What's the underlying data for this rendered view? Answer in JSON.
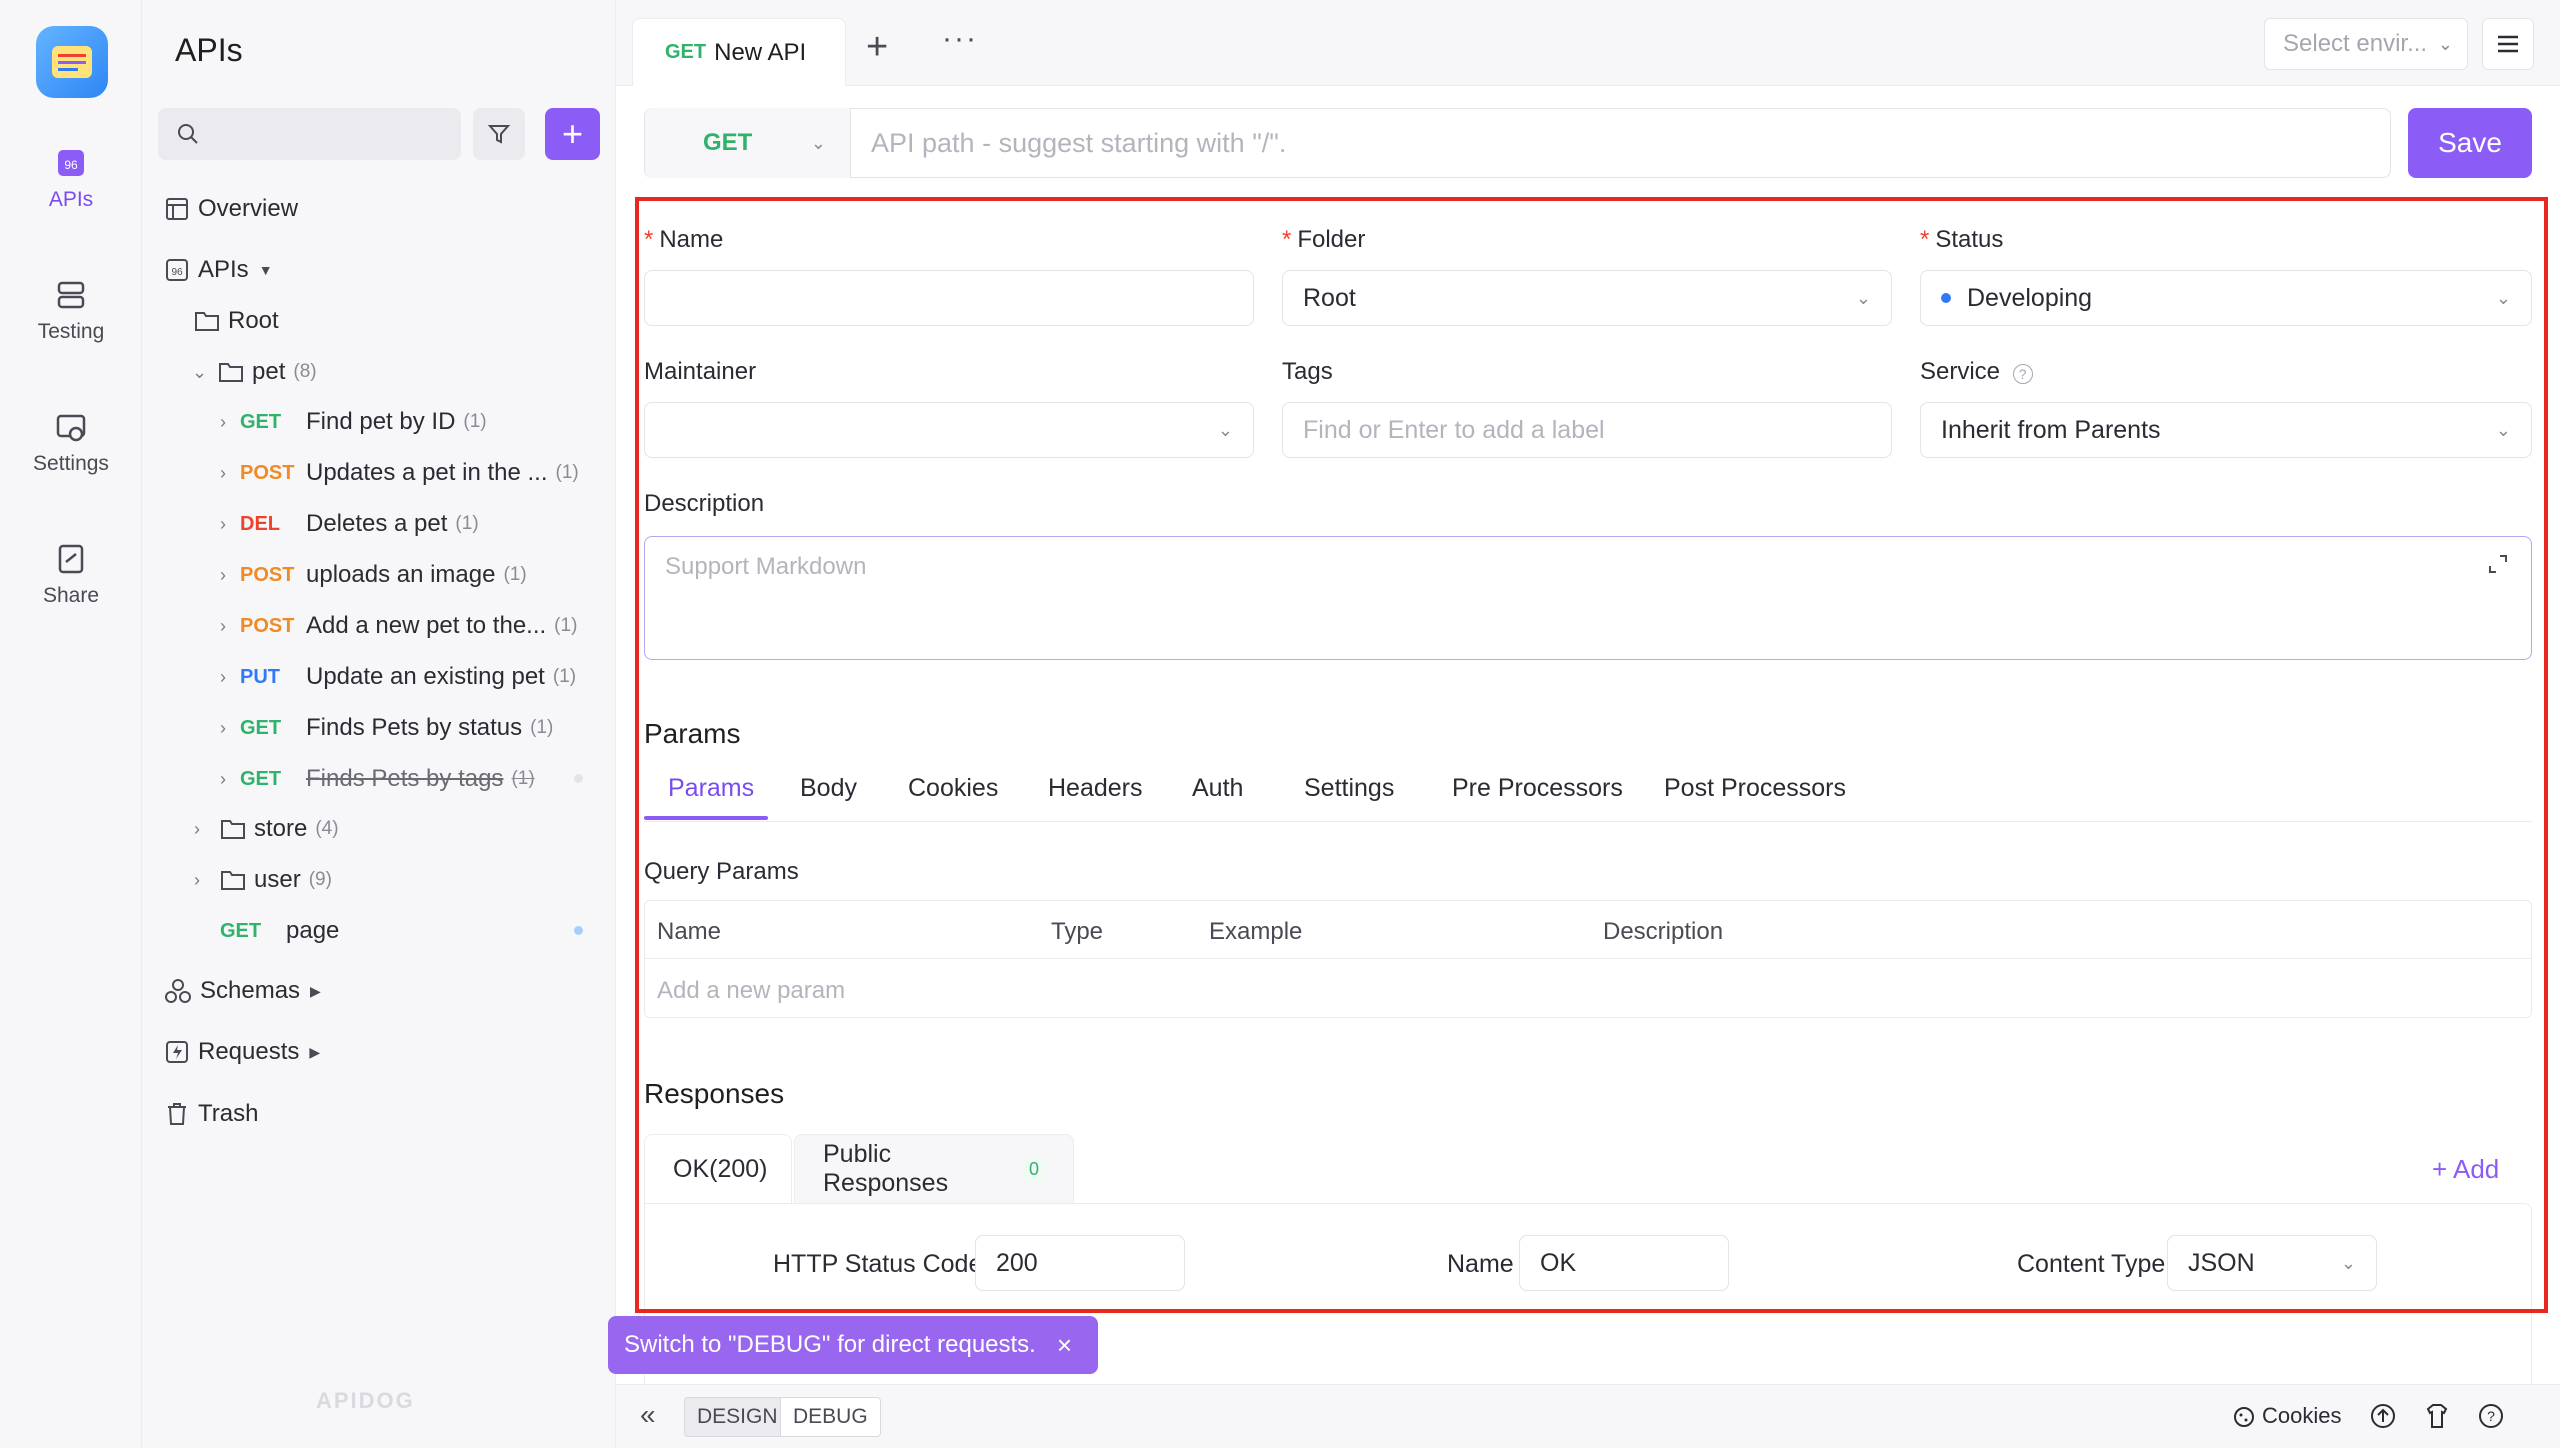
{
  "rail": {
    "items": [
      {
        "label": "APIs",
        "icon": "apis-icon"
      },
      {
        "label": "Testing",
        "icon": "testing-icon"
      },
      {
        "label": "Settings",
        "icon": "settings-icon"
      },
      {
        "label": "Share",
        "icon": "share-icon"
      }
    ]
  },
  "sidebar": {
    "title": "APIs",
    "overview": "Overview",
    "apis": "APIs",
    "root": "Root",
    "pet": {
      "label": "pet",
      "count": "(8)"
    },
    "endpoints": [
      {
        "method": "GET",
        "label": "Find pet by ID",
        "count": "(1)"
      },
      {
        "method": "POST",
        "label": "Updates a pet in the ...",
        "count": "(1)"
      },
      {
        "method": "DEL",
        "label": "Deletes a pet",
        "count": "(1)"
      },
      {
        "method": "POST",
        "label": "uploads an image",
        "count": "(1)"
      },
      {
        "method": "POST",
        "label": "Add a new pet to the...",
        "count": "(1)"
      },
      {
        "method": "PUT",
        "label": "Update an existing pet",
        "count": "(1)"
      },
      {
        "method": "GET",
        "label": "Finds Pets by status",
        "count": "(1)"
      },
      {
        "method": "GET",
        "label": "Finds Pets by tags",
        "count": "(1)"
      }
    ],
    "store": {
      "label": "store",
      "count": "(4)"
    },
    "user": {
      "label": "user",
      "count": "(9)"
    },
    "page": {
      "method": "GET",
      "label": "page"
    },
    "schemas": "Schemas",
    "requests": "Requests",
    "trash": "Trash",
    "watermark": "APIDOG"
  },
  "tabbar": {
    "tab": {
      "method": "GET",
      "label": "New API"
    },
    "env_placeholder": "Select envir..."
  },
  "path": {
    "method": "GET",
    "placeholder": "API path - suggest starting with \"/\".",
    "save": "Save"
  },
  "form": {
    "name": {
      "label": "Name",
      "value": ""
    },
    "folder": {
      "label": "Folder",
      "value": "Root"
    },
    "status": {
      "label": "Status",
      "value": "Developing"
    },
    "maintainer": {
      "label": "Maintainer",
      "value": ""
    },
    "tags": {
      "label": "Tags",
      "placeholder": "Find or Enter to add a label"
    },
    "service": {
      "label": "Service",
      "value": "Inherit from Parents"
    },
    "description": {
      "label": "Description",
      "placeholder": "Support Markdown"
    }
  },
  "params": {
    "title": "Params",
    "tabs": [
      "Params",
      "Body",
      "Cookies",
      "Headers",
      "Auth",
      "Settings",
      "Pre Processors",
      "Post Processors"
    ],
    "query_title": "Query Params",
    "columns": [
      "Name",
      "Type",
      "Example",
      "Description"
    ],
    "add_placeholder": "Add a new param"
  },
  "responses": {
    "title": "Responses",
    "tabs": [
      {
        "label": "OK(200)"
      },
      {
        "label": "Public Responses",
        "badge": "0"
      }
    ],
    "add": "+ Add",
    "http_status_label": "HTTP Status Code",
    "http_status_value": "200",
    "name_label": "Name",
    "name_value": "OK",
    "content_type_label": "Content Type",
    "content_type_value": "JSON"
  },
  "toast": {
    "text": "Switch to \"DEBUG\" for direct requests.",
    "close": "×"
  },
  "bottom": {
    "design": "DESIGN",
    "debug": "DEBUG",
    "cookies": "Cookies"
  },
  "colors": {
    "accent": "#8b5cf6",
    "get": "#2fb36b",
    "post": "#f08a24",
    "del": "#f0412e",
    "put": "#2f7bf5",
    "highlight": "#e8281f"
  }
}
